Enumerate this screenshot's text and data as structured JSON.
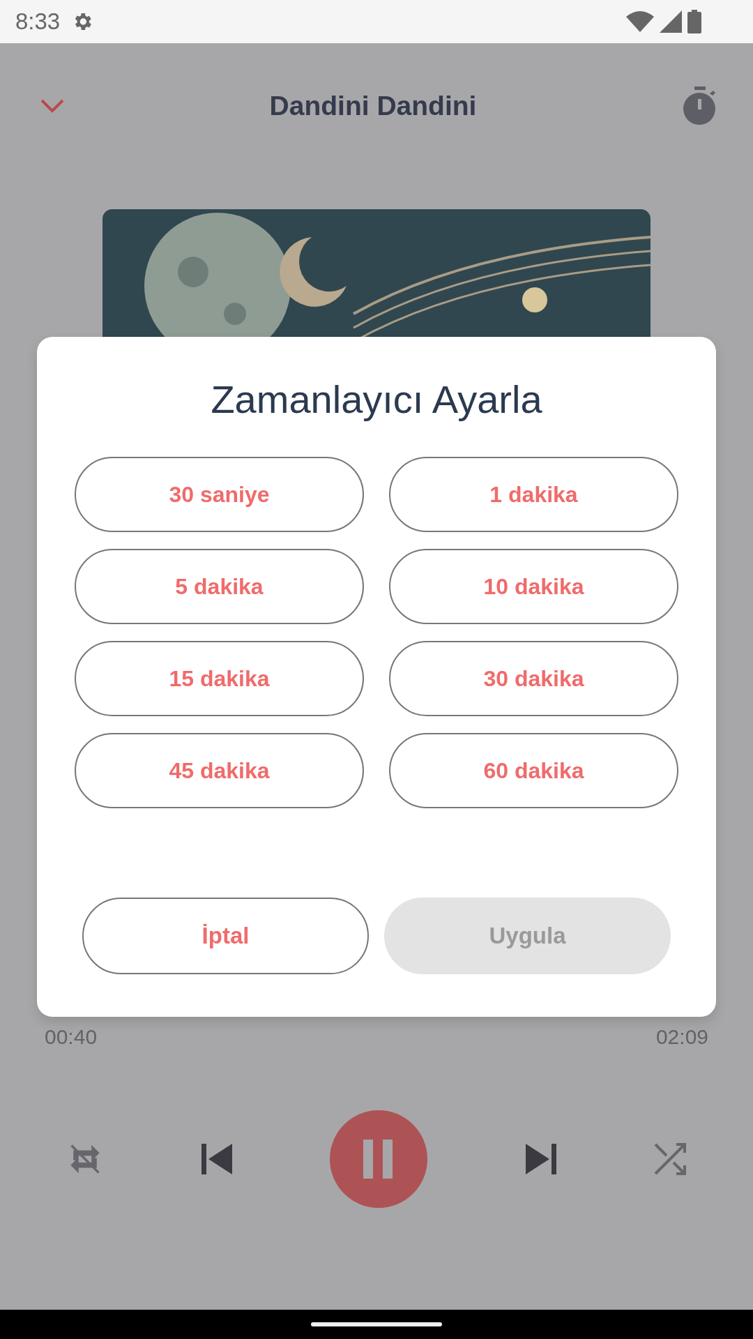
{
  "status_bar": {
    "time": "8:33"
  },
  "header": {
    "title": "Dandini Dandini"
  },
  "progress": {
    "elapsed": "00:40",
    "total": "02:09"
  },
  "dialog": {
    "title": "Zamanlayıcı Ayarla",
    "options": [
      {
        "label": "30 saniye"
      },
      {
        "label": "1 dakika"
      },
      {
        "label": "5 dakika"
      },
      {
        "label": "10 dakika"
      },
      {
        "label": "15 dakika"
      },
      {
        "label": "30 dakika"
      },
      {
        "label": "45 dakika"
      },
      {
        "label": "60 dakika"
      }
    ],
    "buttons": [
      {
        "label": "İptal",
        "disabled": false
      },
      {
        "label": "Uygula",
        "disabled": true
      }
    ]
  }
}
